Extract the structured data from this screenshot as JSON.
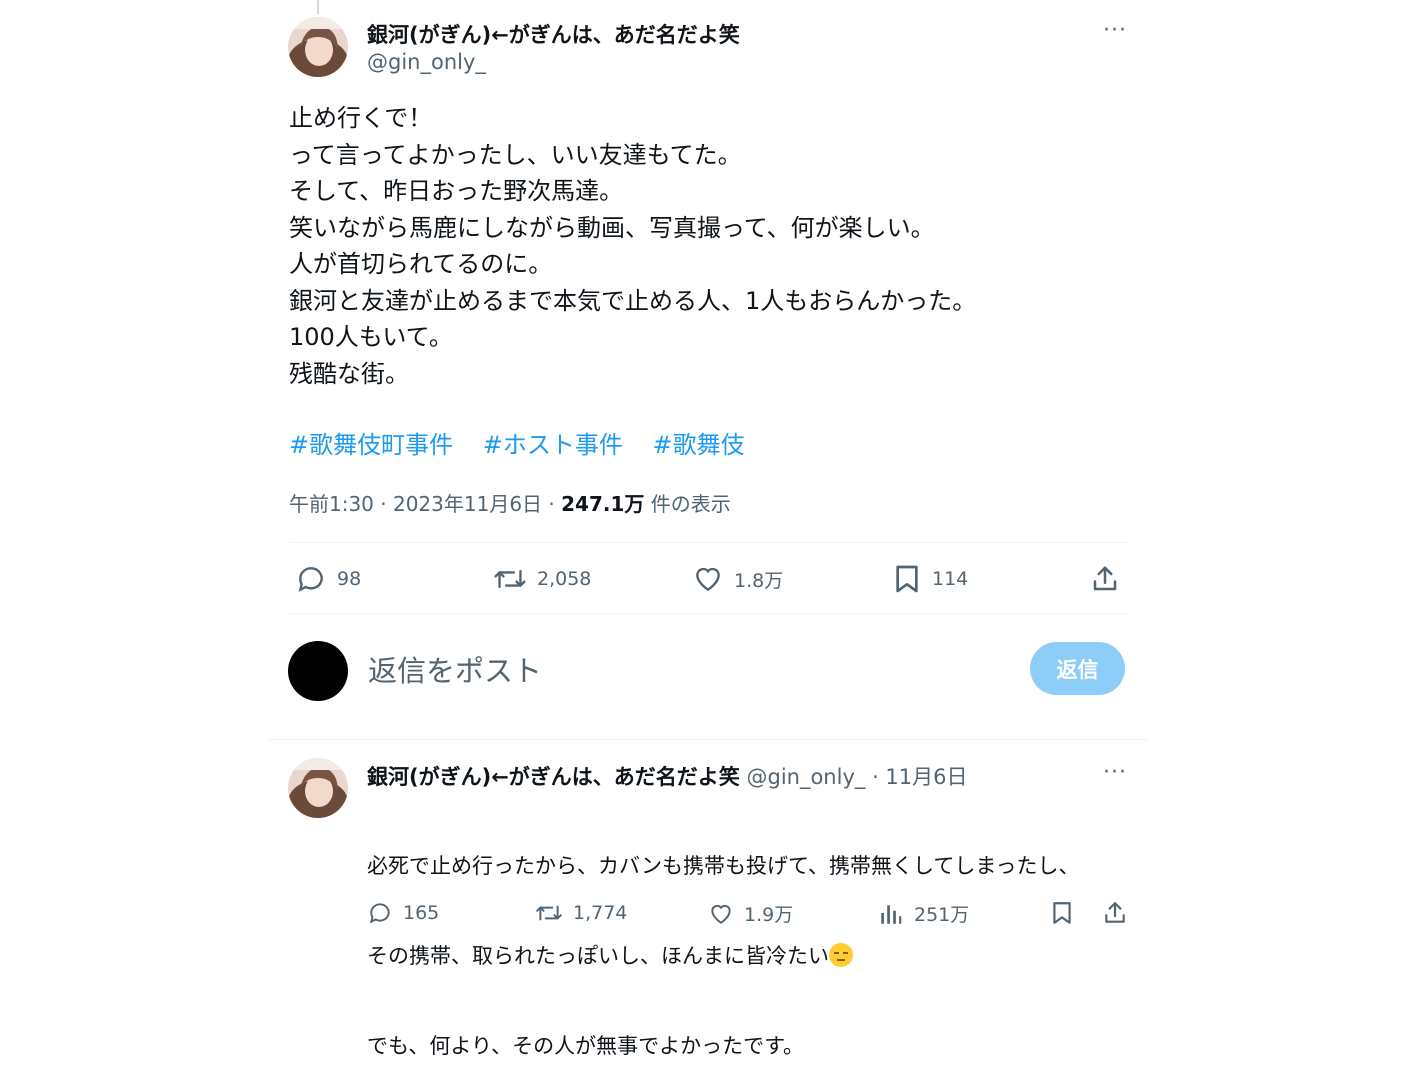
{
  "tweet": {
    "author_name": "銀河(がぎん)←がぎんは、あだ名だよ笑",
    "author_handle": "@gin_only_",
    "more": "···",
    "text": "止め行くで！\nって言ってよかったし、いい友達もてた。\nそして、昨日おった野次馬達。\n笑いながら馬鹿にしながら動画、写真撮って、何が楽しい。\n人が首切られてるのに。\n銀河と友達が止めるまで本気で止める人、1人もおらんかった。\n100人もいて。\n残酷な街。",
    "hashtags": [
      "#歌舞伎町事件",
      "#ホスト事件",
      "#歌舞伎"
    ],
    "time": "午前1:30 · 2023年11月6日 · ",
    "views_count": "247.1万",
    "views_suffix": " 件の表示",
    "stats": {
      "replies": "98",
      "retweets": "2,058",
      "likes": "1.8万",
      "bookmarks": "114"
    }
  },
  "composer": {
    "placeholder": "返信をポスト",
    "button": "返信"
  },
  "reply_tweet": {
    "author_name": "銀河(がぎん)←がぎんは、あだ名だよ笑",
    "author_handle": "@gin_only_",
    "date": " · 11月6日",
    "more": "···",
    "line1": "必死で止め行ったから、カバンも携帯も投げて、携帯無くしてしまったし、",
    "line2": "その携帯、取られたっぽいし、ほんまに皆冷たい",
    "line3": "でも、何より、その人が無事でよかったです。",
    "stats": {
      "replies": "165",
      "retweets": "1,774",
      "likes": "1.9万",
      "views": "251万"
    }
  },
  "colors": {
    "accent": "#1d9bf0",
    "muted": "#536471",
    "reply_button": "#8ecdf8"
  }
}
